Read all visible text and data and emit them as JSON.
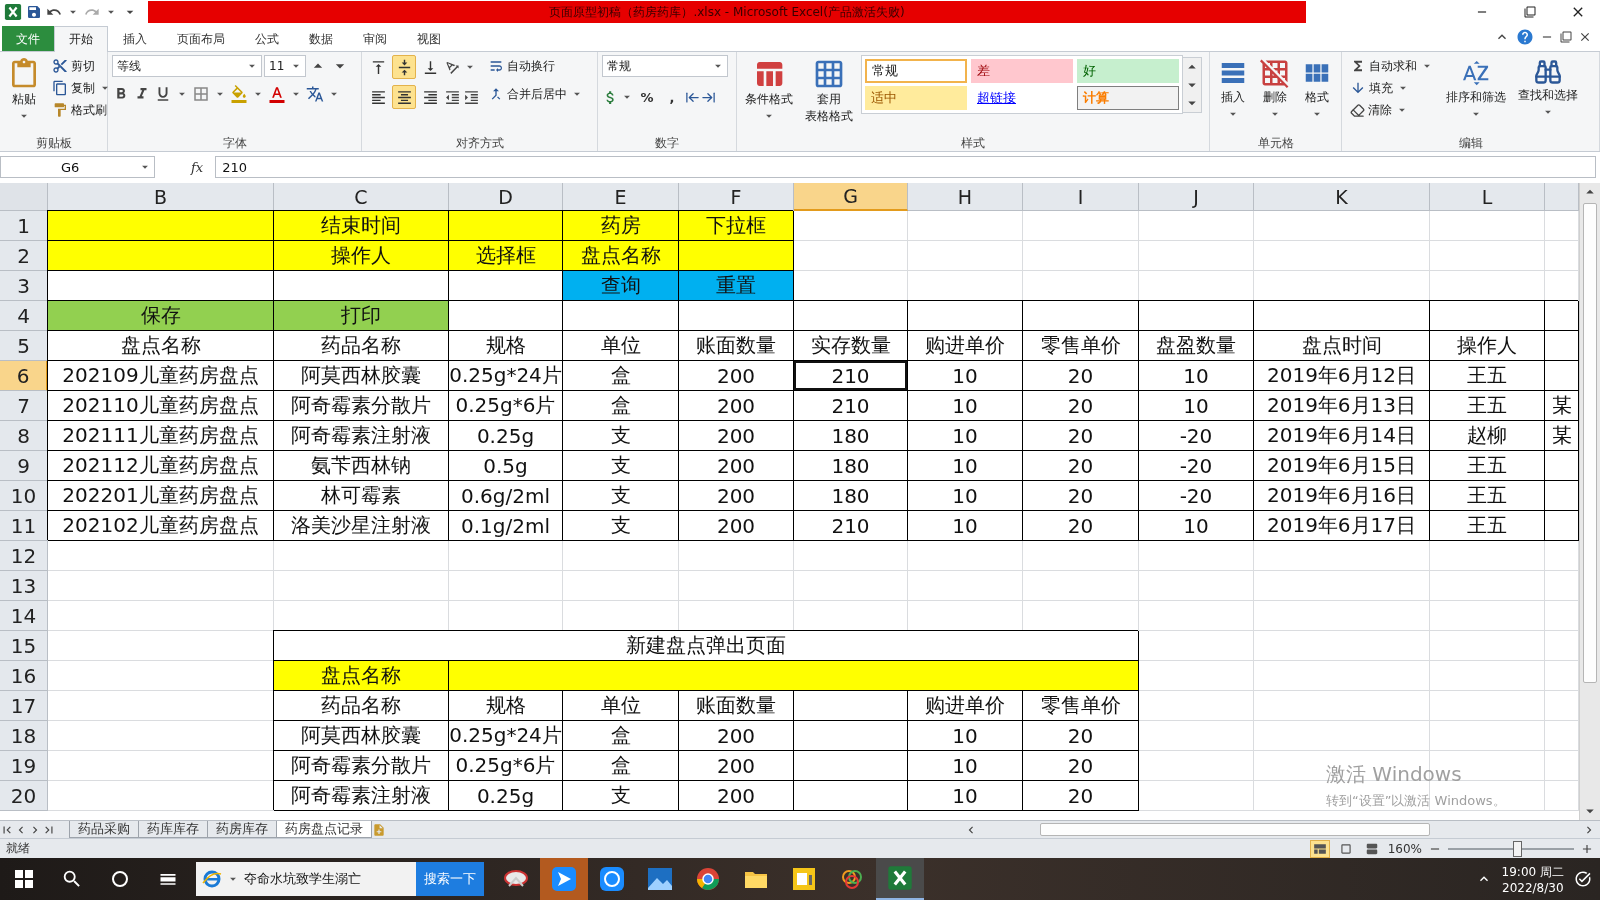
{
  "title_bar": {
    "title": "页面原型初稿（药房药库）.xlsx  -  Microsoft Excel(产品激活失败)"
  },
  "ribbon_tabs": [
    {
      "label": "文件",
      "kind": "file",
      "selected": false
    },
    {
      "label": "开始",
      "kind": "tab",
      "selected": true
    },
    {
      "label": "插入",
      "kind": "tab",
      "selected": false
    },
    {
      "label": "页面布局",
      "kind": "tab",
      "selected": false
    },
    {
      "label": "公式",
      "kind": "tab",
      "selected": false
    },
    {
      "label": "数据",
      "kind": "tab",
      "selected": false
    },
    {
      "label": "审阅",
      "kind": "tab",
      "selected": false
    },
    {
      "label": "视图",
      "kind": "tab",
      "selected": false
    }
  ],
  "ribbon": {
    "clipboard": {
      "label": "剪贴板",
      "paste": "粘贴",
      "cut": "剪切",
      "copy": "复制",
      "format_painter": "格式刷"
    },
    "font": {
      "label": "字体",
      "font_name": "等线",
      "font_size": "11"
    },
    "alignment": {
      "label": "对齐方式",
      "wrap_text": "自动换行",
      "merge_center": "合并后居中",
      "vertical": [
        {
          "kind": "top",
          "selected": false
        },
        {
          "kind": "middle",
          "selected": true
        },
        {
          "kind": "bottom",
          "selected": false
        }
      ],
      "horizontal": [
        {
          "kind": "left",
          "selected": false
        },
        {
          "kind": "center",
          "selected": true
        },
        {
          "kind": "right",
          "selected": false
        }
      ]
    },
    "number": {
      "label": "数字",
      "format": "常规",
      "percent": "%",
      "comma": ","
    },
    "styles": {
      "label": "样式",
      "conditional": "条件格式",
      "table_format": [
        "套用",
        "表格格式"
      ],
      "gallery": [
        {
          "label": "常规",
          "kind": "normal",
          "selected": true
        },
        {
          "label": "差",
          "kind": "bad",
          "selected": false
        },
        {
          "label": "好",
          "kind": "good",
          "selected": false
        },
        {
          "label": "适中",
          "kind": "neutral",
          "selected": false
        },
        {
          "label": "超链接",
          "kind": "hyperlink",
          "selected": false
        },
        {
          "label": "计算",
          "kind": "calculation",
          "selected": false
        }
      ]
    },
    "cells": {
      "label": "单元格",
      "insert": "插入",
      "delete": "删除",
      "format": "格式"
    },
    "editing": {
      "label": "编辑",
      "autosum": "自动求和",
      "fill": "填充",
      "clear": "清除",
      "sort_filter": "排序和筛选",
      "find_select": "查找和选择"
    }
  },
  "formula_bar": {
    "name_box": "G6",
    "fx": "fx",
    "value": "210"
  },
  "sheet": {
    "columns": [
      {
        "label": "B",
        "selected": false
      },
      {
        "label": "C",
        "selected": false
      },
      {
        "label": "D",
        "selected": false
      },
      {
        "label": "E",
        "selected": false
      },
      {
        "label": "F",
        "selected": false
      },
      {
        "label": "G",
        "selected": true
      },
      {
        "label": "H",
        "selected": false
      },
      {
        "label": "I",
        "selected": false
      },
      {
        "label": "J",
        "selected": false
      },
      {
        "label": "K",
        "selected": false
      },
      {
        "label": "L",
        "selected": false
      }
    ],
    "rows": [
      {
        "number": "1",
        "selected": false,
        "cells": [
          {
            "color": "#ffff00"
          },
          {
            "text": "结束时间",
            "color": "#ffff00"
          },
          {
            "color": "#ffff00"
          },
          {
            "text": "药房",
            "color": "#ffff00"
          },
          {
            "text": "下拉框",
            "color": "#ffff00"
          }
        ]
      },
      {
        "number": "2",
        "selected": false,
        "cells": [
          {
            "color": "#ffff00"
          },
          {
            "text": "操作人",
            "color": "#ffff00"
          },
          {
            "text": "选择框",
            "color": "#ffff00"
          },
          {
            "text": "盘点名称",
            "color": "#ffff00"
          },
          {
            "color": "#ffff00"
          }
        ]
      },
      {
        "number": "3",
        "selected": false,
        "cells": [
          {},
          {},
          {},
          {
            "text": "查询",
            "color": "#00b0f0"
          },
          {
            "text": "重置",
            "color": "#00b0f0"
          }
        ]
      },
      {
        "number": "4",
        "selected": false,
        "cells": [
          {
            "text": "保存",
            "color": "#92d050"
          },
          {
            "text": "打印",
            "color": "#92d050"
          },
          {},
          {},
          {},
          {},
          {},
          {},
          {},
          {},
          {},
          {}
        ]
      },
      {
        "number": "5",
        "selected": false,
        "cells": [
          {
            "text": "盘点名称"
          },
          {
            "text": "药品名称"
          },
          {
            "text": "规格"
          },
          {
            "text": "单位"
          },
          {
            "text": "账面数量"
          },
          {
            "text": "实存数量"
          },
          {
            "text": "购进单价"
          },
          {
            "text": "零售单价"
          },
          {
            "text": "盘盈数量"
          },
          {
            "text": "盘点时间"
          },
          {
            "text": "操作人"
          },
          {}
        ]
      },
      {
        "number": "6",
        "selected": true,
        "cells": [
          {
            "text": "202109儿童药房盘点"
          },
          {
            "text": "阿莫西林胶囊"
          },
          {
            "text": "0.25g*24片"
          },
          {
            "text": "盒"
          },
          {
            "text": "200"
          },
          {
            "text": "210"
          },
          {
            "text": "10"
          },
          {
            "text": "20"
          },
          {
            "text": "10"
          },
          {
            "text": "2019年6月12日"
          },
          {
            "text": "王五"
          },
          {}
        ]
      },
      {
        "number": "7",
        "selected": false,
        "cells": [
          {
            "text": "202110儿童药房盘点"
          },
          {
            "text": "阿奇霉素分散片"
          },
          {
            "text": "0.25g*6片"
          },
          {
            "text": "盒"
          },
          {
            "text": "200"
          },
          {
            "text": "210"
          },
          {
            "text": "10"
          },
          {
            "text": "20"
          },
          {
            "text": "10"
          },
          {
            "text": "2019年6月13日"
          },
          {
            "text": "王五"
          },
          {
            "text": "某"
          }
        ]
      },
      {
        "number": "8",
        "selected": false,
        "cells": [
          {
            "text": "202111儿童药房盘点"
          },
          {
            "text": "阿奇霉素注射液"
          },
          {
            "text": "0.25g"
          },
          {
            "text": "支"
          },
          {
            "text": "200"
          },
          {
            "text": "180"
          },
          {
            "text": "10"
          },
          {
            "text": "20"
          },
          {
            "text": "-20"
          },
          {
            "text": "2019年6月14日"
          },
          {
            "text": "赵柳"
          },
          {
            "text": "某"
          }
        ]
      },
      {
        "number": "9",
        "selected": false,
        "cells": [
          {
            "text": "202112儿童药房盘点"
          },
          {
            "text": "氨苄西林钠"
          },
          {
            "text": "0.5g"
          },
          {
            "text": "支"
          },
          {
            "text": "200"
          },
          {
            "text": "180"
          },
          {
            "text": "10"
          },
          {
            "text": "20"
          },
          {
            "text": "-20"
          },
          {
            "text": "2019年6月15日"
          },
          {
            "text": "王五"
          },
          {}
        ]
      },
      {
        "number": "10",
        "selected": false,
        "cells": [
          {
            "text": "202201儿童药房盘点"
          },
          {
            "text": "林可霉素"
          },
          {
            "text": "0.6g/2ml"
          },
          {
            "text": "支"
          },
          {
            "text": "200"
          },
          {
            "text": "180"
          },
          {
            "text": "10"
          },
          {
            "text": "20"
          },
          {
            "text": "-20"
          },
          {
            "text": "2019年6月16日"
          },
          {
            "text": "王五"
          },
          {}
        ]
      },
      {
        "number": "11",
        "selected": false,
        "cells": [
          {
            "text": "202102儿童药房盘点"
          },
          {
            "text": "洛美沙星注射液"
          },
          {
            "text": "0.1g/2ml"
          },
          {
            "text": "支"
          },
          {
            "text": "200"
          },
          {
            "text": "210"
          },
          {
            "text": "10"
          },
          {
            "text": "20"
          },
          {
            "text": "10"
          },
          {
            "text": "2019年6月17日"
          },
          {
            "text": "王五"
          },
          {}
        ]
      },
      {
        "number": "12",
        "selected": false
      },
      {
        "number": "13",
        "selected": false
      },
      {
        "number": "14",
        "selected": false
      },
      {
        "number": "15",
        "selected": false,
        "cells": [
          {
            "bordered": false
          },
          {
            "text": "新建盘点弹出页面",
            "merged": true
          }
        ]
      },
      {
        "number": "16",
        "selected": false,
        "cells": [
          {
            "bordered": false
          },
          {
            "text": "盘点名称",
            "color": "#ffff00"
          },
          {
            "merged": true,
            "color": "#ffff00"
          }
        ]
      },
      {
        "number": "17",
        "selected": false,
        "cells": [
          {
            "bordered": false
          },
          {
            "text": "药品名称"
          },
          {
            "text": "规格"
          },
          {
            "text": "单位"
          },
          {
            "text": "账面数量"
          },
          {},
          {
            "text": "购进单价"
          },
          {
            "text": "零售单价"
          }
        ]
      },
      {
        "number": "18",
        "selected": false,
        "cells": [
          {
            "bordered": false
          },
          {
            "text": "阿莫西林胶囊"
          },
          {
            "text": "0.25g*24片"
          },
          {
            "text": "盒"
          },
          {
            "text": "200"
          },
          {},
          {
            "text": "10"
          },
          {
            "text": "20"
          }
        ]
      },
      {
        "number": "19",
        "selected": false,
        "cells": [
          {
            "bordered": false
          },
          {
            "text": "阿奇霉素分散片"
          },
          {
            "text": "0.25g*6片"
          },
          {
            "text": "盒"
          },
          {
            "text": "200"
          },
          {},
          {
            "text": "10"
          },
          {
            "text": "20"
          }
        ]
      },
      {
        "number": "20",
        "selected": false,
        "cells": [
          {
            "bordered": false
          },
          {
            "text": "阿奇霉素注射液"
          },
          {
            "text": "0.25g"
          },
          {
            "text": "支"
          },
          {
            "text": "200"
          },
          {},
          {
            "text": "10"
          },
          {
            "text": "20"
          }
        ]
      }
    ]
  },
  "activation": {
    "title": "激活 Windows",
    "hint": "转到“设置”以激活 Windows。"
  },
  "sheet_tabs": [
    {
      "label": "药品采购",
      "selected": false
    },
    {
      "label": "药库库存",
      "selected": false
    },
    {
      "label": "药房库存",
      "selected": false
    },
    {
      "label": "药房盘点记录",
      "selected": true
    }
  ],
  "status_bar": {
    "status": "就绪",
    "views": [
      {
        "kind": "normal",
        "selected": true
      },
      {
        "kind": "page_layout",
        "selected": false
      },
      {
        "kind": "page_break",
        "selected": false
      }
    ],
    "zoom": "160%",
    "zoom_slider": {
      "level": 0.55
    }
  },
  "taskbar": {
    "search_text": "夺命水坑致学生溺亡",
    "search_button": "搜索一下",
    "apps": [
      {
        "kind": "dish",
        "selected": false,
        "flashing": false
      },
      {
        "kind": "plane",
        "selected": false,
        "flashing": true
      },
      {
        "kind": "ring",
        "selected": false,
        "flashing": false
      },
      {
        "kind": "photos",
        "selected": false,
        "flashing": false
      },
      {
        "kind": "globe",
        "selected": false,
        "flashing": false
      },
      {
        "kind": "folder",
        "selected": false,
        "flashing": false
      },
      {
        "kind": "slides",
        "selected": false,
        "flashing": false
      },
      {
        "kind": "rings",
        "selected": false,
        "flashing": false
      },
      {
        "kind": "sheet",
        "selected": true,
        "flashing": false
      }
    ],
    "time": "19:00 周二",
    "date": "2022/8/30"
  }
}
